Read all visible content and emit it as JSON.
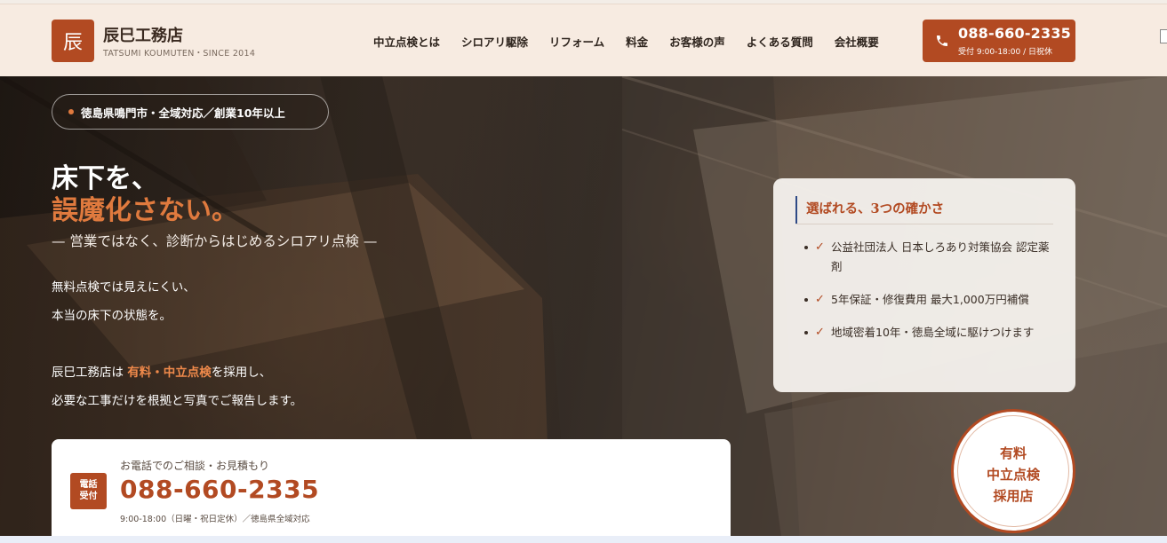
{
  "brand": {
    "logo_char": "辰",
    "name": "辰巳工務店",
    "subtitle": "TATSUMI KOUMUTEN・SINCE 2014"
  },
  "nav": [
    {
      "label": "中立点検とは"
    },
    {
      "label": "シロアリ駆除"
    },
    {
      "label": "リフォーム"
    },
    {
      "label": "料金"
    },
    {
      "label": "お客様の声"
    },
    {
      "label": "よくある質問"
    },
    {
      "label": "会社概要"
    }
  ],
  "header_cta": {
    "phone": "088-660-2335",
    "hours": "受付 9:00-18:00 / 日祝休",
    "icon": "phone-icon"
  },
  "hero": {
    "tag": "徳島県鳴門市・全域対応／創業10年以上",
    "headline_line1": "床下を、",
    "headline_line2": "誤魔化さない。",
    "subheading": "— 営業ではなく、診断からはじめるシロアリ点検 —",
    "para_line1": "無料点検では見えにくい、",
    "para_line2": "本当の床下の状態を。",
    "para_line3_prefix": "辰巳工務店は ",
    "para_line3_highlight": "有料・中立点検",
    "para_line3_suffix": "を採用し、",
    "para_line4": "必要な工事だけを根拠と写真でご報告します。"
  },
  "phone_card": {
    "badge_line1": "電話",
    "badge_line2": "受付",
    "label": "お電話でのご相談・お見積もり",
    "phone": "088-660-2335",
    "hours": "9:00-18:00（日曜・祝日定休）／徳島県全域対応"
  },
  "reasons": {
    "title": "選ばれる、3つの確かさ",
    "items": [
      {
        "text": "公益社団法人 日本しろあり対策協会 認定薬剤"
      },
      {
        "text": "5年保証・修復費用 最大1,000万円補償"
      },
      {
        "text": "地域密着10年・徳島全域に駆けつけます"
      }
    ]
  },
  "stamp": {
    "line1": "有料",
    "line2": "中立点検",
    "line3": "採用店"
  },
  "colors": {
    "accent": "#b24a22",
    "highlight": "#e07a3e",
    "header_bg": "#f7ebe1"
  }
}
